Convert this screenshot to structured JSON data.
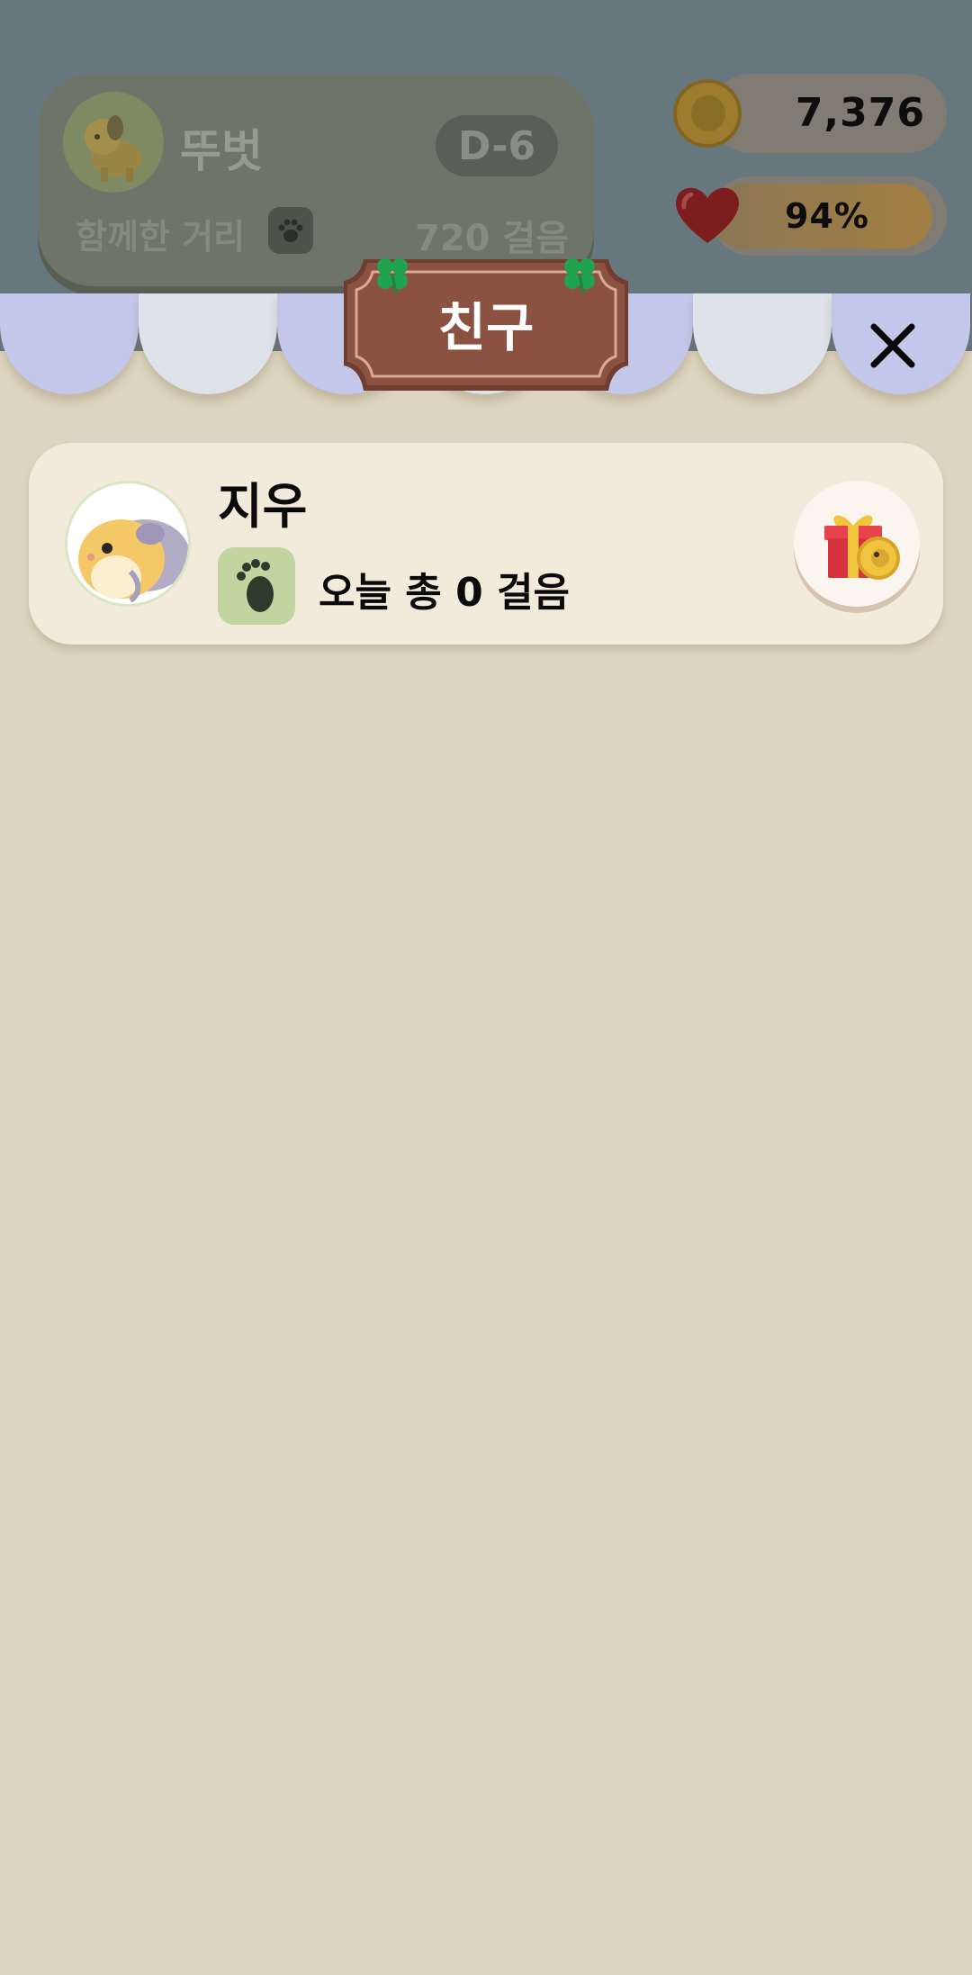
{
  "background_hud": {
    "pet_name": "뚜벗",
    "d_day": "D-6",
    "distance_label": "함께한 거리",
    "distance_value": "720 걸음",
    "coins": "7,376",
    "happiness": "94%",
    "happiness_level": 0.94
  },
  "dialog": {
    "title": "친구",
    "close_icon": "close-icon"
  },
  "friends": [
    {
      "name": "지우",
      "steps_today": "오늘 총 0 걸음",
      "avatar_icon": "hamster-avatar",
      "gift_icon": "gift-coin-icon"
    }
  ],
  "colors": {
    "panel": "#ddd5bf",
    "card": "#f2eada",
    "sign": "#8b5242",
    "awning_blue": "#c3c8ea",
    "awning_white": "#dfe2e9",
    "clover": "#1fa34f"
  }
}
